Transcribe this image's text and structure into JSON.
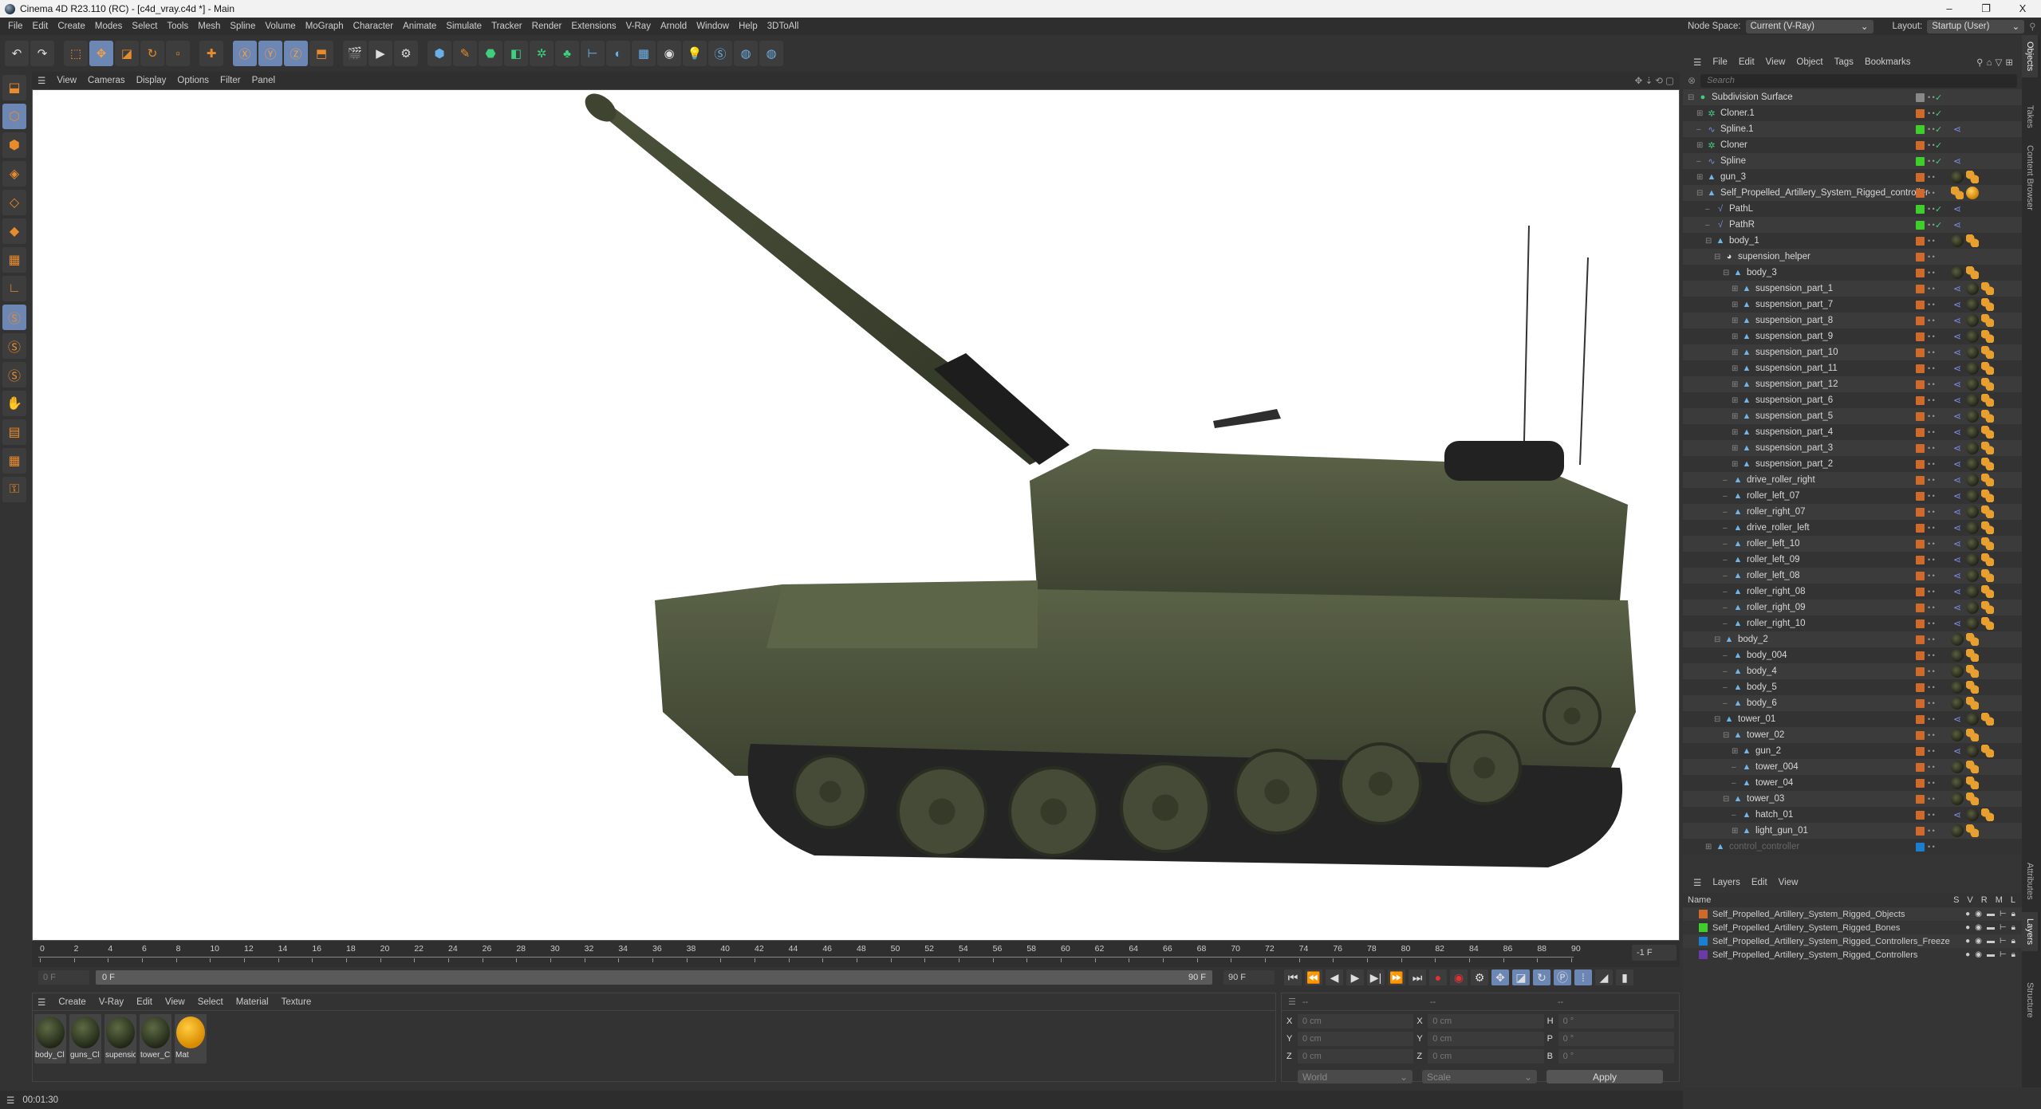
{
  "window": {
    "title": "Cinema 4D R23.110 (RC) - [c4d_vray.c4d *] - Main",
    "minimize": "–",
    "maximize": "❐",
    "close": "X"
  },
  "menubar": [
    "File",
    "Edit",
    "Create",
    "Modes",
    "Select",
    "Tools",
    "Mesh",
    "Spline",
    "Volume",
    "MoGraph",
    "Character",
    "Animate",
    "Simulate",
    "Tracker",
    "Render",
    "Extensions",
    "V-Ray",
    "Arnold",
    "Window",
    "Help",
    "3DToAll"
  ],
  "topright": {
    "node_space_label": "Node Space:",
    "node_space_value": "Current (V-Ray)",
    "layout_label": "Layout:",
    "layout_value": "Startup (User)"
  },
  "toolbar": {
    "icons": [
      "undo-icon",
      "redo-icon",
      "live-selection-icon",
      "move-icon",
      "scale-icon",
      "rotate-icon",
      "recent-tools-icon",
      "move-tool-icon",
      "x-axis-icon",
      "y-axis-icon",
      "z-axis-icon",
      "coordinate-system-icon",
      "render-view-icon",
      "render-picture-viewer-icon",
      "render-settings-icon",
      "cube-icon",
      "pen-icon",
      "subdivision-icon",
      "extrude-icon",
      "cloner-icon",
      "boole-icon",
      "deformer-icon",
      "field-icon",
      "floor-icon",
      "camera-icon",
      "light-icon",
      "vray-icon",
      "python-icon",
      "python2-icon"
    ],
    "axes": [
      "X",
      "Y",
      "Z"
    ]
  },
  "viewport": {
    "menu": [
      "View",
      "Cameras",
      "Display",
      "Options",
      "Filter",
      "Panel"
    ]
  },
  "left_tools": [
    "make-editable-icon",
    "model-mode-icon",
    "texture-mode-icon",
    "point-mode-icon",
    "edge-mode-icon",
    "polygon-mode-icon",
    "uv-mode-icon",
    "axis-mode-icon",
    "snap-icon",
    "snap2-icon",
    "snap3-icon",
    "brush-icon",
    "workplane-icon",
    "grid-icon",
    "lock-icon"
  ],
  "timeline": {
    "ticks": [
      "0",
      "2",
      "4",
      "6",
      "8",
      "10",
      "12",
      "14",
      "16",
      "18",
      "20",
      "22",
      "24",
      "26",
      "28",
      "30",
      "32",
      "34",
      "36",
      "38",
      "40",
      "42",
      "44",
      "46",
      "48",
      "50",
      "52",
      "54",
      "56",
      "58",
      "60",
      "62",
      "64",
      "66",
      "68",
      "70",
      "72",
      "74",
      "76",
      "78",
      "80",
      "82",
      "84",
      "86",
      "88",
      "90"
    ],
    "current_frame": "-1 F",
    "start_field": "0 F",
    "range_start": "0 F",
    "range_end": "90 F",
    "end_field": "90 F"
  },
  "materials": {
    "menu": [
      "Create",
      "V-Ray",
      "Edit",
      "View",
      "Select",
      "Material",
      "Texture"
    ],
    "items": [
      {
        "name": "body_Cl"
      },
      {
        "name": "guns_Cl"
      },
      {
        "name": "supensic"
      },
      {
        "name": "tower_Cl"
      },
      {
        "name": "Mat"
      }
    ]
  },
  "coords": {
    "headers": [
      "--",
      "--",
      "--"
    ],
    "rows": [
      {
        "l1": "X",
        "v1": "0 cm",
        "l2": "X",
        "v2": "0 cm",
        "l3": "H",
        "v3": "0 °"
      },
      {
        "l1": "Y",
        "v1": "0 cm",
        "l2": "Y",
        "v2": "0 cm",
        "l3": "P",
        "v3": "0 °"
      },
      {
        "l1": "Z",
        "v1": "0 cm",
        "l2": "Z",
        "v2": "0 cm",
        "l3": "B",
        "v3": "0 °"
      }
    ],
    "space": "World",
    "mode": "Scale",
    "apply": "Apply"
  },
  "status": {
    "time": "00:01:30"
  },
  "object_manager": {
    "menu": [
      "File",
      "Edit",
      "View",
      "Object",
      "Tags",
      "Bookmarks"
    ],
    "search_placeholder": "Search",
    "rows": [
      {
        "name": "Subdivision Surface",
        "depth": 0,
        "exp": "⊟",
        "icon": "subdivision",
        "layer": "#888888",
        "check": true,
        "tags": []
      },
      {
        "name": "Cloner.1",
        "depth": 1,
        "exp": "⊞",
        "icon": "cloner",
        "layer": "#d06a2a",
        "check": true,
        "tags": []
      },
      {
        "name": "Spline.1",
        "depth": 1,
        "exp": "",
        "icon": "spline",
        "layer": "#3fcf2a",
        "check": true,
        "tags": [
          "hier"
        ]
      },
      {
        "name": "Cloner",
        "depth": 1,
        "exp": "⊞",
        "icon": "cloner",
        "layer": "#d06a2a",
        "check": true,
        "tags": []
      },
      {
        "name": "Spline",
        "depth": 1,
        "exp": "",
        "icon": "spline",
        "layer": "#3fcf2a",
        "check": true,
        "tags": [
          "hier"
        ]
      },
      {
        "name": "gun_3",
        "depth": 1,
        "exp": "⊞",
        "icon": "poly",
        "layer": "#d06a2a",
        "check": false,
        "tags": [
          "chk",
          "mat",
          "chk",
          "bal"
        ]
      },
      {
        "name": "Self_Propelled_Artillery_System_Rigged_controller",
        "depth": 1,
        "exp": "⊟",
        "icon": "poly",
        "layer": "#d06a2a",
        "check": false,
        "tags": [
          "bal",
          "gold"
        ]
      },
      {
        "name": "PathL",
        "depth": 2,
        "exp": "",
        "icon": "path",
        "layer": "#3fcf2a",
        "check": true,
        "tags": [
          "hier"
        ]
      },
      {
        "name": "PathR",
        "depth": 2,
        "exp": "",
        "icon": "path",
        "layer": "#3fcf2a",
        "check": true,
        "tags": [
          "hier"
        ]
      },
      {
        "name": "body_1",
        "depth": 2,
        "exp": "⊟",
        "icon": "poly",
        "layer": "#d06a2a",
        "check": false,
        "tags": [
          "mat",
          "chk",
          "bal"
        ]
      },
      {
        "name": "supension_helper",
        "depth": 3,
        "exp": "⊟",
        "icon": "helper",
        "layer": "#d06a2a",
        "check": false,
        "tags": []
      },
      {
        "name": "body_3",
        "depth": 4,
        "exp": "⊟",
        "icon": "poly",
        "layer": "#d06a2a",
        "check": false,
        "tags": [
          "mat",
          "chk",
          "bal"
        ]
      },
      {
        "name": "suspension_part_1",
        "depth": 5,
        "exp": "⊞",
        "icon": "poly",
        "layer": "#d06a2a",
        "check": false,
        "tags": [
          "hier",
          "mat",
          "chk",
          "bal"
        ]
      },
      {
        "name": "suspension_part_7",
        "depth": 5,
        "exp": "⊞",
        "icon": "poly",
        "layer": "#d06a2a",
        "check": false,
        "tags": [
          "hier",
          "mat",
          "chk",
          "bal"
        ]
      },
      {
        "name": "suspension_part_8",
        "depth": 5,
        "exp": "⊞",
        "icon": "poly",
        "layer": "#d06a2a",
        "check": false,
        "tags": [
          "hier",
          "mat",
          "chk",
          "bal"
        ]
      },
      {
        "name": "suspension_part_9",
        "depth": 5,
        "exp": "⊞",
        "icon": "poly",
        "layer": "#d06a2a",
        "check": false,
        "tags": [
          "hier",
          "mat",
          "chk",
          "bal"
        ]
      },
      {
        "name": "suspension_part_10",
        "depth": 5,
        "exp": "⊞",
        "icon": "poly",
        "layer": "#d06a2a",
        "check": false,
        "tags": [
          "hier",
          "mat",
          "chk",
          "bal"
        ]
      },
      {
        "name": "suspension_part_11",
        "depth": 5,
        "exp": "⊞",
        "icon": "poly",
        "layer": "#d06a2a",
        "check": false,
        "tags": [
          "hier",
          "mat",
          "chk",
          "bal"
        ]
      },
      {
        "name": "suspension_part_12",
        "depth": 5,
        "exp": "⊞",
        "icon": "poly",
        "layer": "#d06a2a",
        "check": false,
        "tags": [
          "hier",
          "mat",
          "chk",
          "bal"
        ]
      },
      {
        "name": "suspension_part_6",
        "depth": 5,
        "exp": "⊞",
        "icon": "poly",
        "layer": "#d06a2a",
        "check": false,
        "tags": [
          "hier",
          "mat",
          "chk",
          "bal"
        ]
      },
      {
        "name": "suspension_part_5",
        "depth": 5,
        "exp": "⊞",
        "icon": "poly",
        "layer": "#d06a2a",
        "check": false,
        "tags": [
          "hier",
          "mat",
          "chk",
          "bal"
        ]
      },
      {
        "name": "suspension_part_4",
        "depth": 5,
        "exp": "⊞",
        "icon": "poly",
        "layer": "#d06a2a",
        "check": false,
        "tags": [
          "hier",
          "mat",
          "chk",
          "bal"
        ]
      },
      {
        "name": "suspension_part_3",
        "depth": 5,
        "exp": "⊞",
        "icon": "poly",
        "layer": "#d06a2a",
        "check": false,
        "tags": [
          "hier",
          "mat",
          "chk",
          "bal"
        ]
      },
      {
        "name": "suspension_part_2",
        "depth": 5,
        "exp": "⊞",
        "icon": "poly",
        "layer": "#d06a2a",
        "check": false,
        "tags": [
          "hier",
          "mat",
          "chk",
          "bal"
        ]
      },
      {
        "name": "drive_roller_right",
        "depth": 4,
        "exp": "",
        "icon": "poly",
        "layer": "#d06a2a",
        "check": false,
        "tags": [
          "hier",
          "mat",
          "chk",
          "bal"
        ]
      },
      {
        "name": "roller_left_07",
        "depth": 4,
        "exp": "",
        "icon": "poly",
        "layer": "#d06a2a",
        "check": false,
        "tags": [
          "hier",
          "mat",
          "chk",
          "bal"
        ]
      },
      {
        "name": "roller_right_07",
        "depth": 4,
        "exp": "",
        "icon": "poly",
        "layer": "#d06a2a",
        "check": false,
        "tags": [
          "hier",
          "mat",
          "chk",
          "bal"
        ]
      },
      {
        "name": "drive_roller_left",
        "depth": 4,
        "exp": "",
        "icon": "poly",
        "layer": "#d06a2a",
        "check": false,
        "tags": [
          "hier",
          "mat",
          "chk",
          "bal"
        ]
      },
      {
        "name": "roller_left_10",
        "depth": 4,
        "exp": "",
        "icon": "poly",
        "layer": "#d06a2a",
        "check": false,
        "tags": [
          "hier",
          "mat",
          "chk",
          "bal"
        ]
      },
      {
        "name": "roller_left_09",
        "depth": 4,
        "exp": "",
        "icon": "poly",
        "layer": "#d06a2a",
        "check": false,
        "tags": [
          "hier",
          "mat",
          "chk",
          "bal"
        ]
      },
      {
        "name": "roller_left_08",
        "depth": 4,
        "exp": "",
        "icon": "poly",
        "layer": "#d06a2a",
        "check": false,
        "tags": [
          "hier",
          "mat",
          "chk",
          "bal"
        ]
      },
      {
        "name": "roller_right_08",
        "depth": 4,
        "exp": "",
        "icon": "poly",
        "layer": "#d06a2a",
        "check": false,
        "tags": [
          "hier",
          "mat",
          "chk",
          "bal"
        ]
      },
      {
        "name": "roller_right_09",
        "depth": 4,
        "exp": "",
        "icon": "poly",
        "layer": "#d06a2a",
        "check": false,
        "tags": [
          "hier",
          "mat",
          "chk",
          "bal"
        ]
      },
      {
        "name": "roller_right_10",
        "depth": 4,
        "exp": "",
        "icon": "poly",
        "layer": "#d06a2a",
        "check": false,
        "tags": [
          "hier",
          "mat",
          "chk",
          "bal"
        ]
      },
      {
        "name": "body_2",
        "depth": 3,
        "exp": "⊟",
        "icon": "poly",
        "layer": "#d06a2a",
        "check": false,
        "tags": [
          "mat",
          "chk",
          "bal"
        ]
      },
      {
        "name": "body_004",
        "depth": 4,
        "exp": "",
        "icon": "poly",
        "layer": "#d06a2a",
        "check": false,
        "tags": [
          "mat",
          "chk",
          "bal"
        ]
      },
      {
        "name": "body_4",
        "depth": 4,
        "exp": "",
        "icon": "poly",
        "layer": "#d06a2a",
        "check": false,
        "tags": [
          "mat",
          "chk",
          "bal"
        ]
      },
      {
        "name": "body_5",
        "depth": 4,
        "exp": "",
        "icon": "poly",
        "layer": "#d06a2a",
        "check": false,
        "tags": [
          "mat",
          "chk",
          "bal"
        ]
      },
      {
        "name": "body_6",
        "depth": 4,
        "exp": "",
        "icon": "poly",
        "layer": "#d06a2a",
        "check": false,
        "tags": [
          "mat",
          "chk",
          "bal"
        ]
      },
      {
        "name": "tower_01",
        "depth": 3,
        "exp": "⊟",
        "icon": "poly",
        "layer": "#d06a2a",
        "check": false,
        "tags": [
          "hier",
          "mat",
          "chk",
          "bal"
        ]
      },
      {
        "name": "tower_02",
        "depth": 4,
        "exp": "⊟",
        "icon": "poly",
        "layer": "#d06a2a",
        "check": false,
        "tags": [
          "mat",
          "chk",
          "bal"
        ]
      },
      {
        "name": "gun_2",
        "depth": 5,
        "exp": "⊞",
        "icon": "poly",
        "layer": "#d06a2a",
        "check": false,
        "tags": [
          "hier",
          "mat",
          "chk",
          "bal"
        ]
      },
      {
        "name": "tower_004",
        "depth": 5,
        "exp": "",
        "icon": "poly",
        "layer": "#d06a2a",
        "check": false,
        "tags": [
          "mat",
          "chk",
          "bal"
        ]
      },
      {
        "name": "tower_04",
        "depth": 5,
        "exp": "",
        "icon": "poly",
        "layer": "#d06a2a",
        "check": false,
        "tags": [
          "mat",
          "chk",
          "bal"
        ]
      },
      {
        "name": "tower_03",
        "depth": 4,
        "exp": "⊟",
        "icon": "poly",
        "layer": "#d06a2a",
        "check": false,
        "tags": [
          "mat",
          "chk",
          "bal"
        ]
      },
      {
        "name": "hatch_01",
        "depth": 5,
        "exp": "",
        "icon": "poly",
        "layer": "#d06a2a",
        "check": false,
        "tags": [
          "hier",
          "mat",
          "chk",
          "bal"
        ]
      },
      {
        "name": "light_gun_01",
        "depth": 5,
        "exp": "⊞",
        "icon": "poly",
        "layer": "#d06a2a",
        "check": false,
        "tags": [
          "mat",
          "chk",
          "bal"
        ]
      },
      {
        "name": "control_controller",
        "depth": 2,
        "exp": "⊞",
        "icon": "poly",
        "layer": "#1a7fd0",
        "check": false,
        "tags": [],
        "dim": true
      }
    ]
  },
  "layers": {
    "menu": [
      "Layers",
      "Edit",
      "View"
    ],
    "cols": {
      "name": "Name",
      "s": "S",
      "v": "V",
      "r": "R",
      "m": "M",
      "l": "L"
    },
    "items": [
      {
        "name": "Self_Propelled_Artillery_System_Rigged_Objects",
        "color": "#d06a2a"
      },
      {
        "name": "Self_Propelled_Artillery_System_Rigged_Bones",
        "color": "#3fcf2a"
      },
      {
        "name": "Self_Propelled_Artillery_System_Rigged_Controllers_Freeze",
        "color": "#1a7fd0"
      },
      {
        "name": "Self_Propelled_Artillery_System_Rigged_Controllers",
        "color": "#6a3aa8"
      }
    ]
  },
  "side_tabs": [
    "Objects",
    "Takes",
    "Content Browser",
    "Attributes",
    "Layers",
    "Structure"
  ]
}
